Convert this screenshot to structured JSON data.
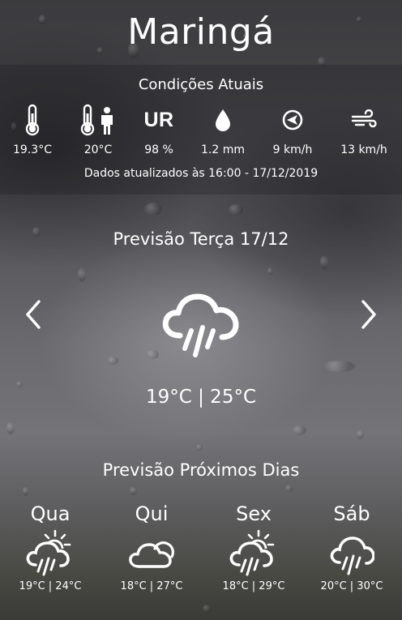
{
  "city": "Maringá",
  "current": {
    "heading": "Condições Atuais",
    "metrics": [
      {
        "icon": "thermometer-icon",
        "value": "19.3°C"
      },
      {
        "icon": "feels-like-icon",
        "value": "20°C"
      },
      {
        "icon": "humidity-ur-icon",
        "label": "UR",
        "value": "98 %"
      },
      {
        "icon": "rain-drop-icon",
        "value": "1.2 mm"
      },
      {
        "icon": "wind-direction-icon",
        "value": "9 km/h"
      },
      {
        "icon": "wind-gust-icon",
        "value": "13 km/h"
      }
    ],
    "updated": "Dados atualizados às 16:00 - 17/12/2019"
  },
  "forecast": {
    "title": "Previsão Terça 17/12",
    "icon": "cloud-heavy-rain-icon",
    "temps": "19°C | 25°C"
  },
  "next_days": {
    "title": "Previsão Próximos Dias",
    "days": [
      {
        "name": "Qua",
        "icon": "sun-cloud-rain-icon",
        "temps": "19°C | 24°C"
      },
      {
        "name": "Qui",
        "icon": "cloud-icon",
        "temps": "18°C | 27°C"
      },
      {
        "name": "Sex",
        "icon": "sun-cloud-rain-icon",
        "temps": "18°C | 29°C"
      },
      {
        "name": "Sáb",
        "icon": "cloud-rain-icon",
        "temps": "20°C | 30°C"
      }
    ]
  },
  "colors": {
    "text": "#ffffff",
    "panel": "#141416"
  }
}
